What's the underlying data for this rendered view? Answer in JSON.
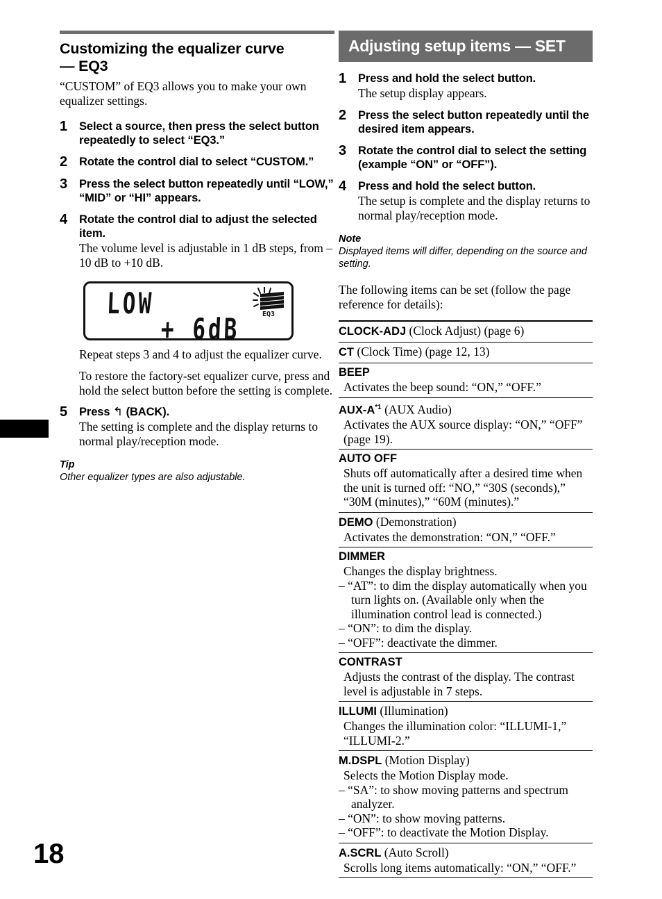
{
  "page": {
    "number": "18"
  },
  "left_column": {
    "title_line1": "Customizing the equalizer curve",
    "title_line2": "— EQ3",
    "intro": "“CUSTOM” of EQ3 allows you to make your own equalizer settings.",
    "steps": [
      {
        "num": "1",
        "head": "Select a source, then press the select button repeatedly to select “EQ3.”",
        "desc": ""
      },
      {
        "num": "2",
        "head": "Rotate the control dial to select “CUSTOM.”",
        "desc": ""
      },
      {
        "num": "3",
        "head": "Press the select button repeatedly until “LOW,” “MID” or “HI” appears.",
        "desc": ""
      },
      {
        "num": "4",
        "head": "Rotate the control dial to adjust the selected item.",
        "desc": "The volume level is adjustable in 1 dB steps, from –10 dB to +10 dB."
      }
    ],
    "step5": {
      "num": "5",
      "head_before": "Press",
      "back_icon": "↰",
      "head_after": "(BACK).",
      "desc": "The setting is complete and the display returns to normal play/reception mode."
    },
    "figure": {
      "lcd_line1": "LOW",
      "lcd_line2": "+ 6dB",
      "eq_icon_label": "EQ3"
    },
    "after_figure": [
      "Repeat steps 3 and 4 to adjust the equalizer curve.",
      "To restore the factory-set equalizer curve, press and hold the select button before the setting is complete."
    ],
    "tip": {
      "label": "Tip",
      "text": "Other equalizer types are also adjustable."
    }
  },
  "right_column": {
    "banner_title": "Adjusting setup items — SET",
    "steps": [
      {
        "num": "1",
        "head": "Press and hold the select button.",
        "desc": "The setup display appears."
      },
      {
        "num": "2",
        "head": "Press the select button repeatedly until the desired item appears.",
        "desc": ""
      },
      {
        "num": "3",
        "head": "Rotate the control dial to select the setting (example “ON” or “OFF”).",
        "desc": ""
      },
      {
        "num": "4",
        "head": "Press and hold the select button.",
        "desc": "The setup is complete and the display returns to normal play/reception mode."
      }
    ],
    "note": {
      "label": "Note",
      "text": "Displayed items will differ, depending on the source and setting."
    },
    "lead_in": "The following items can be set (follow the page reference for details):",
    "settings": [
      {
        "name": "CLOCK-ADJ",
        "sup": "",
        "paren": " (Clock Adjust) (page 6)",
        "desc": "",
        "bullets": []
      },
      {
        "name": "CT",
        "sup": "",
        "paren": " (Clock Time) (page 12, 13)",
        "desc": "",
        "bullets": []
      },
      {
        "name": "BEEP",
        "sup": "",
        "paren": "",
        "desc": "Activates the beep sound: “ON,” “OFF.”",
        "bullets": []
      },
      {
        "name": "AUX-A",
        "sup": "*1",
        "paren": " (AUX Audio)",
        "desc": "Activates the AUX source display: “ON,” “OFF” (page 19).",
        "bullets": []
      },
      {
        "name": "AUTO OFF",
        "sup": "",
        "paren": "",
        "desc": "Shuts off automatically after a desired time when the unit is turned off: “NO,” “30S (seconds),” “30M (minutes),” “60M (minutes).”",
        "bullets": []
      },
      {
        "name": "DEMO",
        "sup": "",
        "paren": " (Demonstration)",
        "desc": "Activates the demonstration: “ON,” “OFF.”",
        "bullets": []
      },
      {
        "name": "DIMMER",
        "sup": "",
        "paren": "",
        "desc": "Changes the display brightness.",
        "bullets": [
          "– “AT”: to dim the display automatically when you turn lights on. (Available only when the illumination control lead is connected.)",
          "– “ON”: to dim the display.",
          "– “OFF”: deactivate the dimmer."
        ]
      },
      {
        "name": "CONTRAST",
        "sup": "",
        "paren": "",
        "desc": "Adjusts the contrast of the display. The contrast level is adjustable in 7 steps.",
        "bullets": []
      },
      {
        "name": "ILLUMI",
        "sup": "",
        "paren": " (Illumination)",
        "desc": "Changes the illumination color: “ILLUMI-1,” “ILLUMI-2.”",
        "bullets": []
      },
      {
        "name": "M.DSPL",
        "sup": "",
        "paren": " (Motion Display)",
        "desc": "Selects the Motion Display mode.",
        "bullets": [
          "– “SA”: to show moving patterns and spectrum analyzer.",
          "– “ON”: to show moving patterns.",
          "– “OFF”: to deactivate the Motion Display."
        ]
      },
      {
        "name": "A.SCRL",
        "sup": "",
        "paren": " (Auto Scroll)",
        "desc": "Scrolls long items automatically: “ON,” “OFF.”",
        "bullets": []
      }
    ]
  },
  "colors": {
    "banner_bg": "#6b6b6b",
    "rule_gray": "#6e6e6e",
    "text": "#000000"
  }
}
